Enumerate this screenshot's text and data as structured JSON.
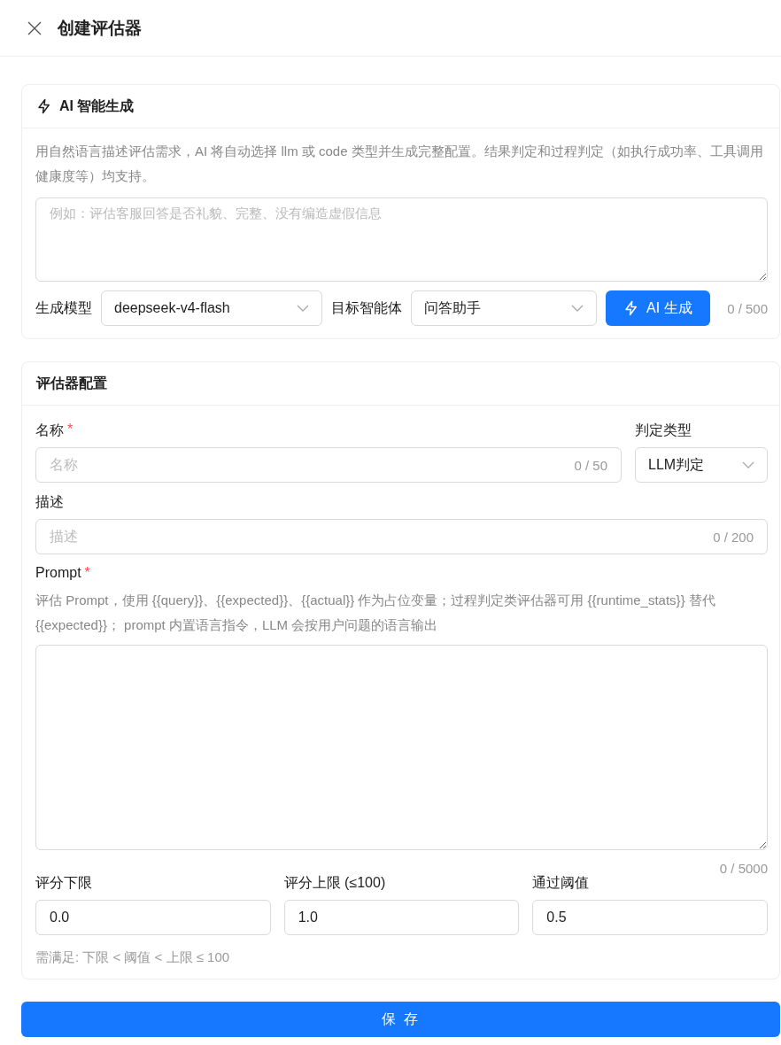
{
  "window": {
    "title": "创建评估器"
  },
  "ai_card": {
    "title": "AI 智能生成",
    "description": "用自然语言描述评估需求，AI 将自动选择 llm 或 code 类型并生成完整配置。结果判定和过程判定（如执行成功率、工具调用健康度等）均支持。",
    "input": {
      "placeholder": "例如：评估客服回答是否礼貌、完整、没有编造虚假信息",
      "counter": "0 / 500"
    },
    "model": {
      "label": "生成模型",
      "value": "deepseek-v4-flash"
    },
    "agent": {
      "label": "目标智能体",
      "value": "问答助手"
    },
    "button": "AI 生成"
  },
  "config_card": {
    "title": "评估器配置",
    "name": {
      "label": "名称",
      "required_mark": "*",
      "placeholder": "名称",
      "counter": "0 / 50"
    },
    "judge_type": {
      "label": "判定类型",
      "value": "LLM判定"
    },
    "description": {
      "label": "描述",
      "placeholder": "描述",
      "counter": "0 / 200"
    },
    "prompt": {
      "label": "Prompt",
      "required_mark": "*",
      "hint": "评估 Prompt，使用 {{query}}、{{expected}}、{{actual}} 作为占位变量；过程判定类评估器可用 {{runtime_stats}} 替代 {{expected}}； prompt 内置语言指令，LLM 会按用户问题的语言输出",
      "counter": "0 / 5000"
    },
    "scores": [
      {
        "label": "评分下限",
        "value": "0.0"
      },
      {
        "label": "评分上限 (≤100)",
        "value": "1.0"
      },
      {
        "label": "通过阈值",
        "value": "0.5"
      }
    ],
    "rule": "需满足: 下限 < 阈值 < 上限 ≤ 100"
  },
  "save_button": "保 存"
}
